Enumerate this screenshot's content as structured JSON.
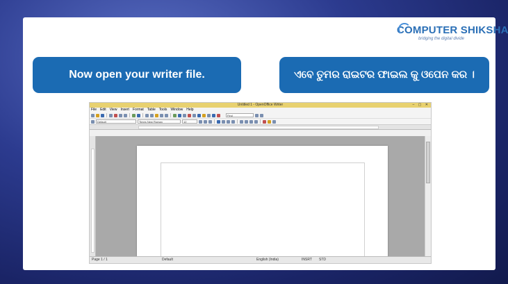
{
  "logo": {
    "brand": "COMPUTER SHIKSHA",
    "tagline": "bridging the digital divide"
  },
  "callouts": {
    "english": "Now open your writer file.",
    "odia": "ଏବେ ତୁମର ରାଇଟର ଫାଇଲ କୁ ଓପେନ କର ।"
  },
  "writer": {
    "title": "Untitled 1 - OpenOffice Writer",
    "menu": [
      "File",
      "Edit",
      "View",
      "Insert",
      "Format",
      "Table",
      "Tools",
      "Window",
      "Help"
    ],
    "style_value": "Default",
    "font_value": "Times New Roman",
    "size_value": "12",
    "find_placeholder": "Find",
    "status": {
      "page": "Page 1 / 1",
      "style": "Default",
      "language": "English (India)",
      "insert_mode": "INSRT",
      "selection_mode": "STD"
    }
  },
  "colors": {
    "callout_bg": "#1b6bb3",
    "brand_blue": "#2a6fb6",
    "titlebar": "#e8d170"
  }
}
